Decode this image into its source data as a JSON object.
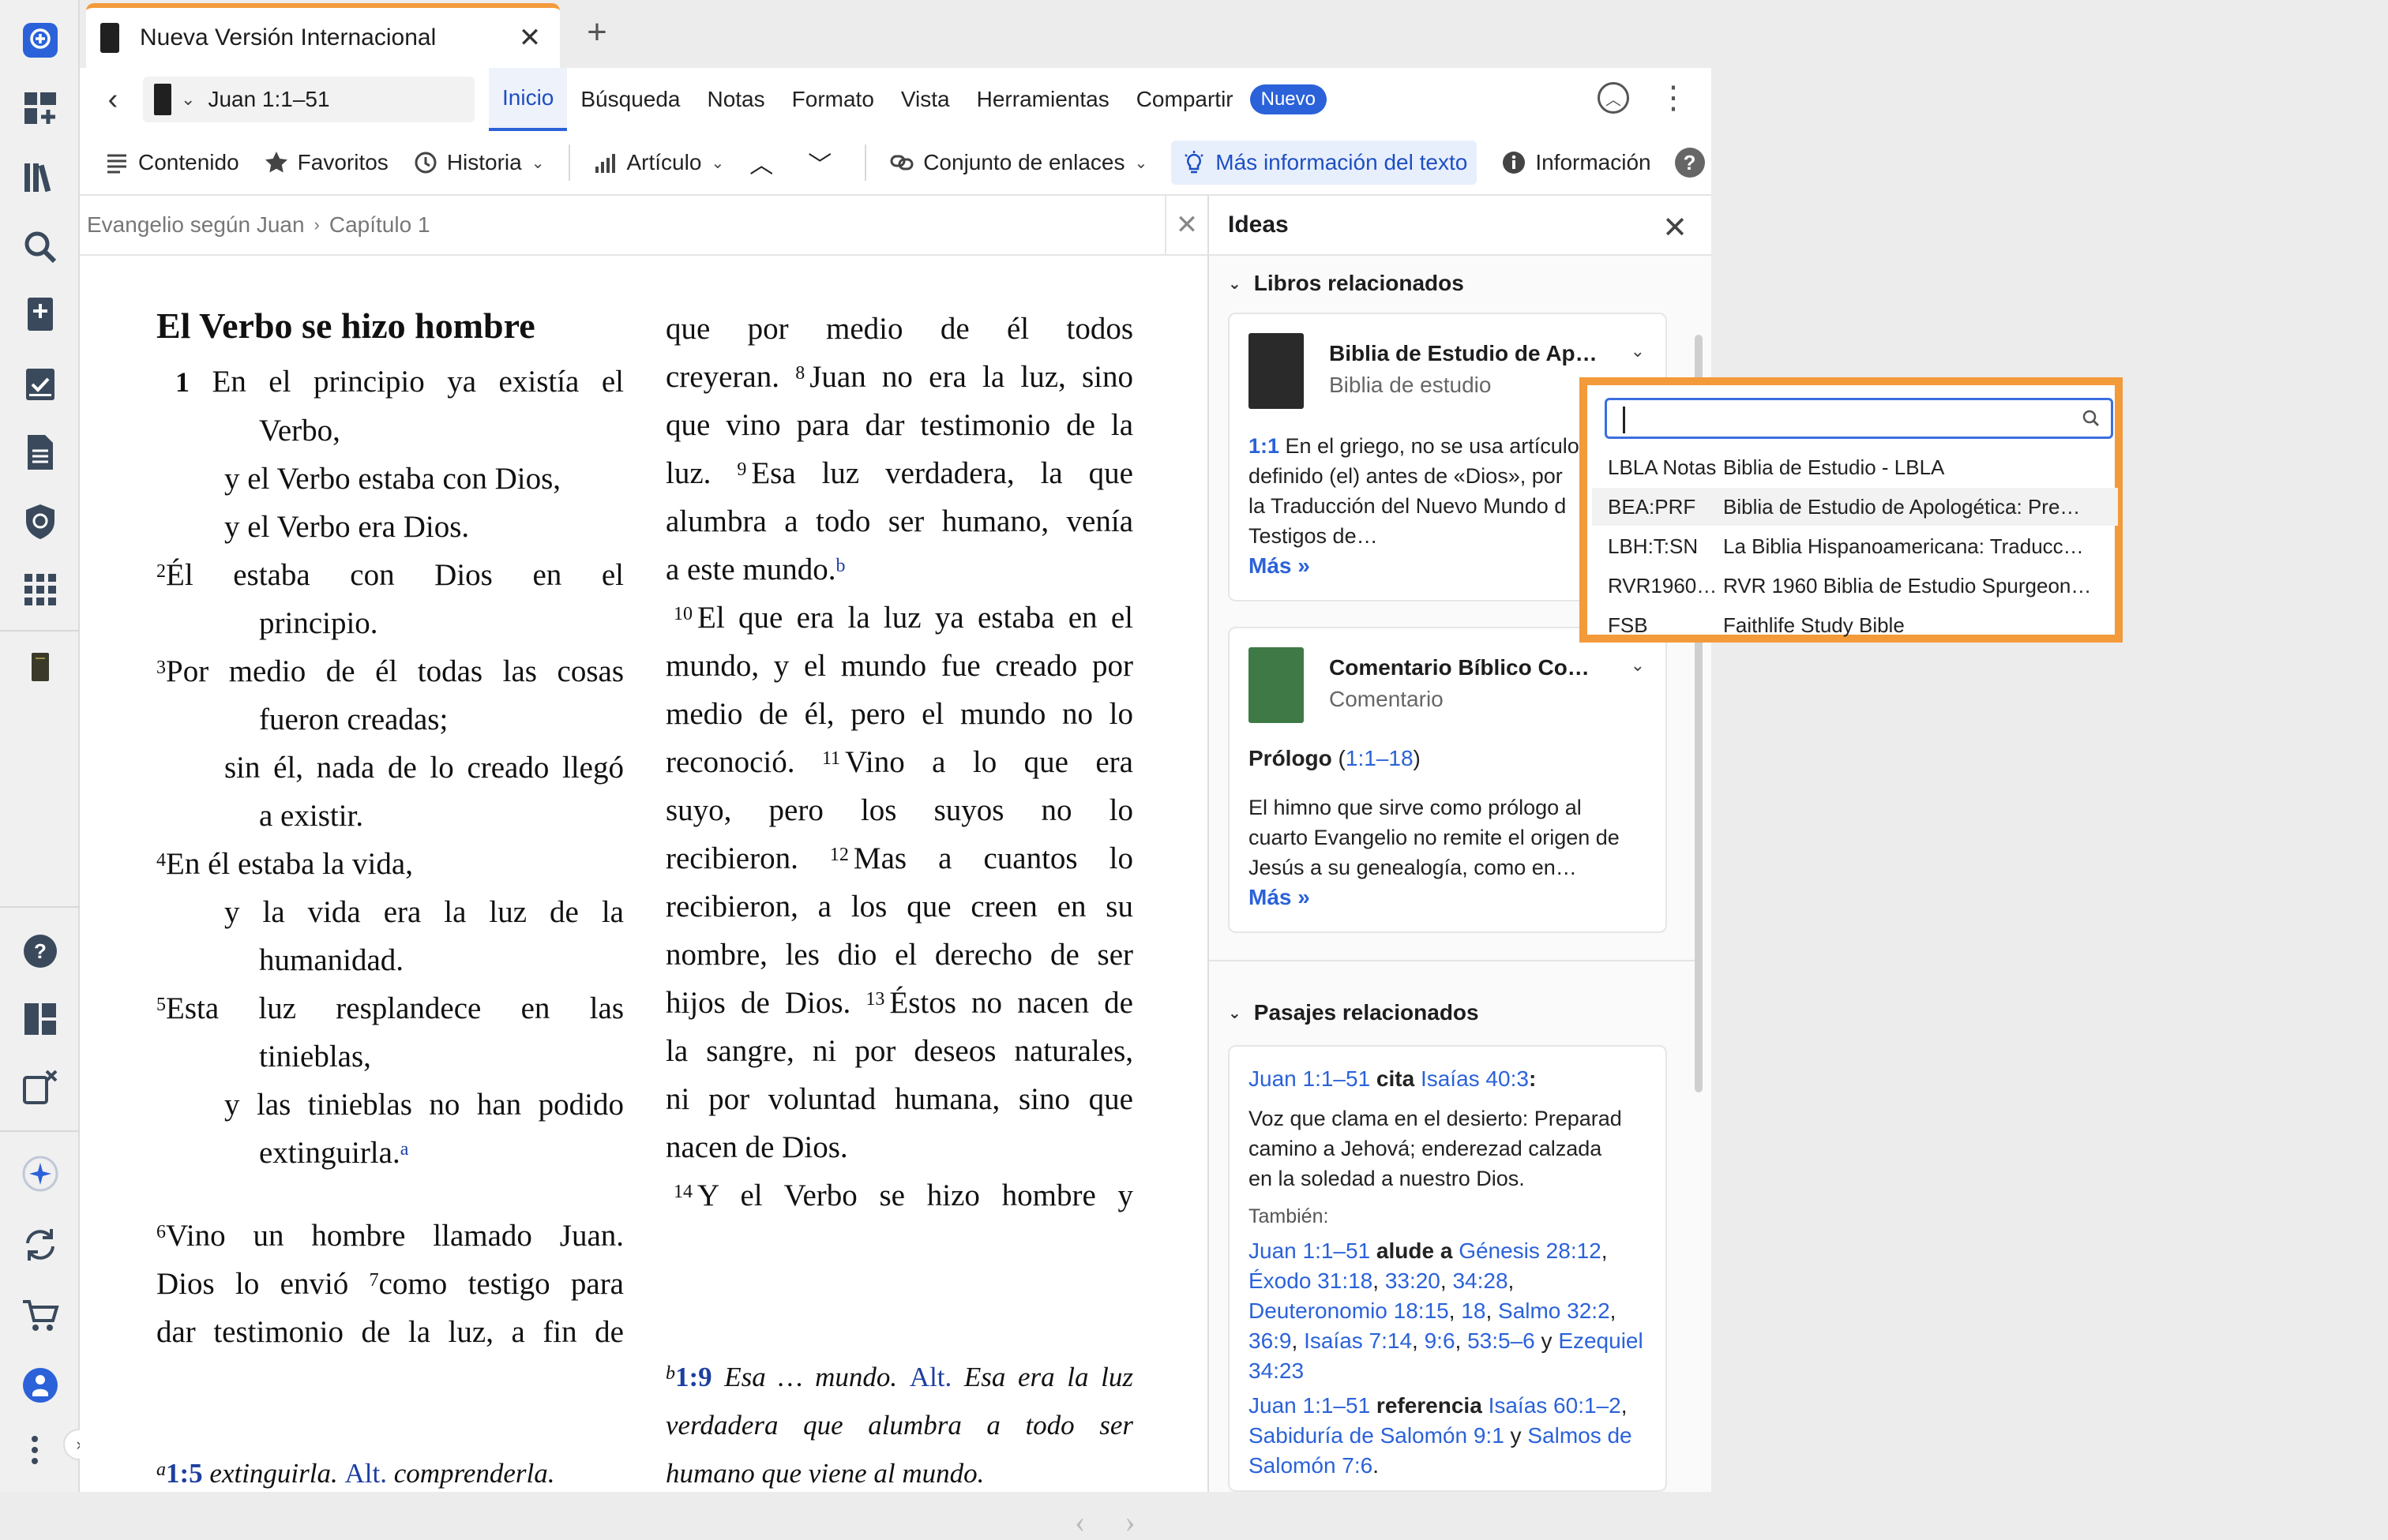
{
  "tab": {
    "title": "Nueva Versión Internacional",
    "close": "✕",
    "new": "+"
  },
  "nav": {
    "back": "‹",
    "reference": "Juan 1:1–51",
    "menu": [
      "Inicio",
      "Búsqueda",
      "Notas",
      "Formato",
      "Vista",
      "Herramientas",
      "Compartir"
    ],
    "badge": "Nuevo"
  },
  "toolbar": {
    "contenido": "Contenido",
    "favoritos": "Favoritos",
    "historia": "Historia",
    "articulo": "Artículo",
    "enlaces": "Conjunto de enlaces",
    "masinfo": "Más información del texto",
    "info": "Información",
    "help": "?"
  },
  "breadcrumb": {
    "book": "Evangelio según Juan",
    "chapter": "Capítulo 1"
  },
  "bible": {
    "heading": "El Verbo se hizo hombre",
    "col1": [
      {
        "n": "1",
        "t": " En el principio ya existía el",
        "c": "in1"
      },
      {
        "t": "Verbo,",
        "c": "in3 left"
      },
      {
        "t": "y el Verbo estaba con Dios,",
        "c": "in2 left"
      },
      {
        "t": "y el Verbo era Dios.",
        "c": "in2 left"
      },
      {
        "s": "2",
        "t": "Él estaba con Dios en el",
        "c": ""
      },
      {
        "t": "principio.",
        "c": "in3 left"
      },
      {
        "s": "3",
        "t": "Por medio de él todas las cosas",
        "c": ""
      },
      {
        "t": "fueron creadas;",
        "c": "in3 left"
      },
      {
        "t": "sin él, nada de lo creado llegó",
        "c": "in2"
      },
      {
        "t": "a existir.",
        "c": "in3 left"
      },
      {
        "s": "4",
        "t": "En él estaba la vida,",
        "c": "left"
      },
      {
        "t": "y la vida era la luz de la",
        "c": "in2"
      },
      {
        "t": "humanidad.",
        "c": "in3 left"
      },
      {
        "s": "5",
        "t": "Esta luz resplandece en las",
        "c": ""
      },
      {
        "t": "tinieblas,",
        "c": "in3 left"
      },
      {
        "t": "y las tinieblas no han podido",
        "c": "in2"
      },
      {
        "t": "extinguirla.",
        "c": "in3 left",
        "fn": "a"
      }
    ],
    "col1b": [
      {
        "s": "6",
        "t": "Vino un hombre llamado Juan."
      },
      {
        "t": "Dios lo envió ",
        "s2": "7",
        "t2": "como testigo para"
      },
      {
        "t": "dar testimonio de la luz, a fin de"
      }
    ],
    "col2": [
      "que por medio de él todos",
      "creyeran. |8|Juan no era la luz, sino",
      "que vino para dar testimonio de la",
      "luz. |9|Esa luz verdadera, la que",
      "alumbra a todo ser humano, venía",
      "a este mundo.",
      "|10|El que era la luz ya estaba en el",
      "mundo, y el mundo fue creado por",
      "medio de él, pero el mundo no lo",
      "reconoció. |11|Vino a lo que era",
      "suyo, pero los suyos no lo",
      "recibieron. |12|Mas a cuantos lo",
      "recibieron, a los que creen en su",
      "nombre, les dio el derecho de ser",
      "hijos de Dios. |13|Éstos no nacen de",
      "la sangre, ni por deseos naturales,",
      "ni por voluntad humana, sino que",
      "nacen de Dios.",
      "|14|Y el Verbo se hizo hombre y"
    ],
    "fn_b": "b",
    "foot_a": {
      "mark": "a",
      "ref": "1:5",
      "text": " extinguirla. ",
      "alt": "Alt.",
      "rest": " comprenderla."
    },
    "foot_b": {
      "mark": "b",
      "ref": "1:9",
      "text": " Esa … mundo. ",
      "alt": "Alt.",
      "rest1": " Esa era la luz",
      "line2": "verdadera que alumbra a todo ser",
      "line3": "humano que viene al mundo."
    }
  },
  "ideas": {
    "title": "Ideas",
    "sec1": "Libros relacionados",
    "card1": {
      "title": "Biblia de Estudio de Ap…",
      "type": "Biblia de estudio",
      "ref": "1:1",
      "l1": " En el griego, no se usa artículo",
      "l2": "definido (el) antes de «Dios», por",
      "l3": "la Traducción del Nuevo Mundo d",
      "l4": "Testigos de…",
      "more": "Más »"
    },
    "card2": {
      "title": "Comentario Bíblico Co…",
      "type": "Comentario",
      "h": "Prólogo",
      "href": "1:1–18",
      "l1": "El himno que sirve como prólogo al",
      "l2": "cuarto Evangelio no remite el origen de",
      "l3": "Jesús a su genealogía, como en…",
      "more": "Más »"
    },
    "sec2": "Pasajes relacionados",
    "card3": {
      "ref": "Juan 1:1–51",
      "cita": " cita ",
      "target": "Isaías 40:3",
      "colon": ":",
      "q1": "Voz que clama en el desierto: Preparad",
      "q2": "camino a Jehová; enderezad calzada",
      "q3": "en la soledad a nuestro Dios.",
      "tambien": "También:",
      "a1": "Juan 1:1–51",
      "alude": " alude a ",
      "g": "Génesis 28:12",
      "e1": "Éxodo 31:18",
      "e2": "33:20",
      "e3": "34:28",
      "d1": "Deuteronomio 18:15",
      "d2": "18",
      "s1": "Salmo 32:2",
      "s2": "36:9",
      "i1": "Isaías 7:14",
      "i2": "9:6",
      "i3": "53:5–6",
      "y": " y ",
      "ez": "Ezequiel",
      "ez2": "34:23",
      "r1": "Juan 1:1–51",
      "refer": " referencia ",
      "is2": "Isaías 60:1–2",
      "sab": "Sabiduría de Salomón 9:1",
      "sal": "Salmos de",
      "sal2": "Salomón 7:6"
    }
  },
  "popup": {
    "search_placeholder": "",
    "rows": [
      {
        "ab": "LBLA Notas",
        "nm": "Biblia de Estudio - LBLA"
      },
      {
        "ab": "BEA:PRF",
        "nm": "Biblia de Estudio de Apologética: Pre…"
      },
      {
        "ab": "LBH:T:SN",
        "nm": "La Biblia Hispanoamericana: Traducc…"
      },
      {
        "ab": "RVR1960…",
        "nm": "RVR 1960 Biblia de Estudio Spurgeon…"
      },
      {
        "ab": "FSB",
        "nm": "Faithlife Study Bible"
      }
    ]
  },
  "colors": {
    "accent": "#2b62d9",
    "highlight": "#f39a3a"
  }
}
